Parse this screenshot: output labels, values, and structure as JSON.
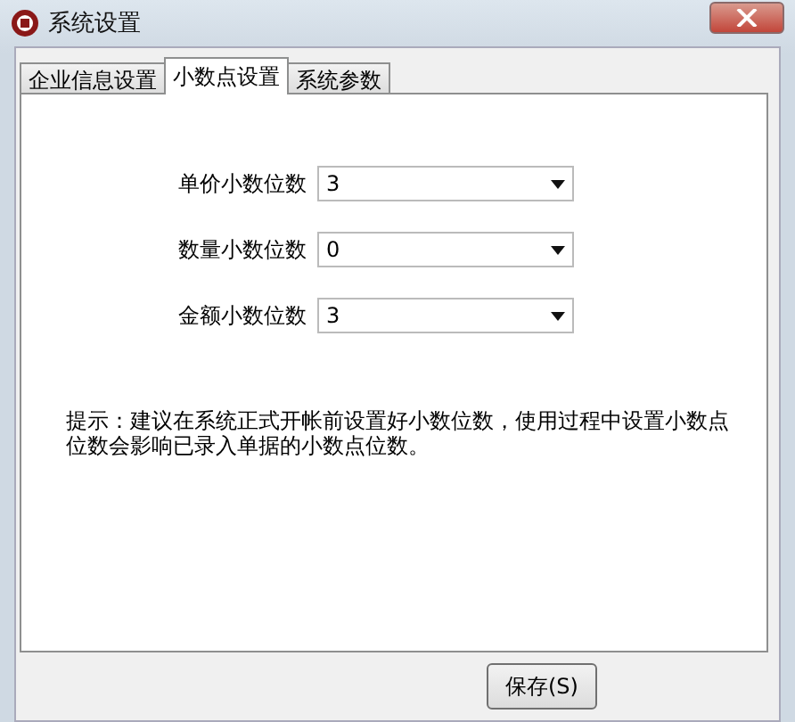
{
  "window": {
    "title": "系统设置"
  },
  "tabs": [
    {
      "label": "企业信息设置",
      "selected": false
    },
    {
      "label": "小数点设置",
      "selected": true
    },
    {
      "label": "系统参数",
      "selected": false
    }
  ],
  "fields": [
    {
      "label": "单价小数位数",
      "value": "3"
    },
    {
      "label": "数量小数位数",
      "value": "0"
    },
    {
      "label": "金额小数位数",
      "value": "3"
    }
  ],
  "hint": "提示：建议在系统正式开帐前设置好小数位数，使用过程中设置小数点位数会影响已录入单据的小数点位数。",
  "buttons": [
    "保存(S)"
  ]
}
